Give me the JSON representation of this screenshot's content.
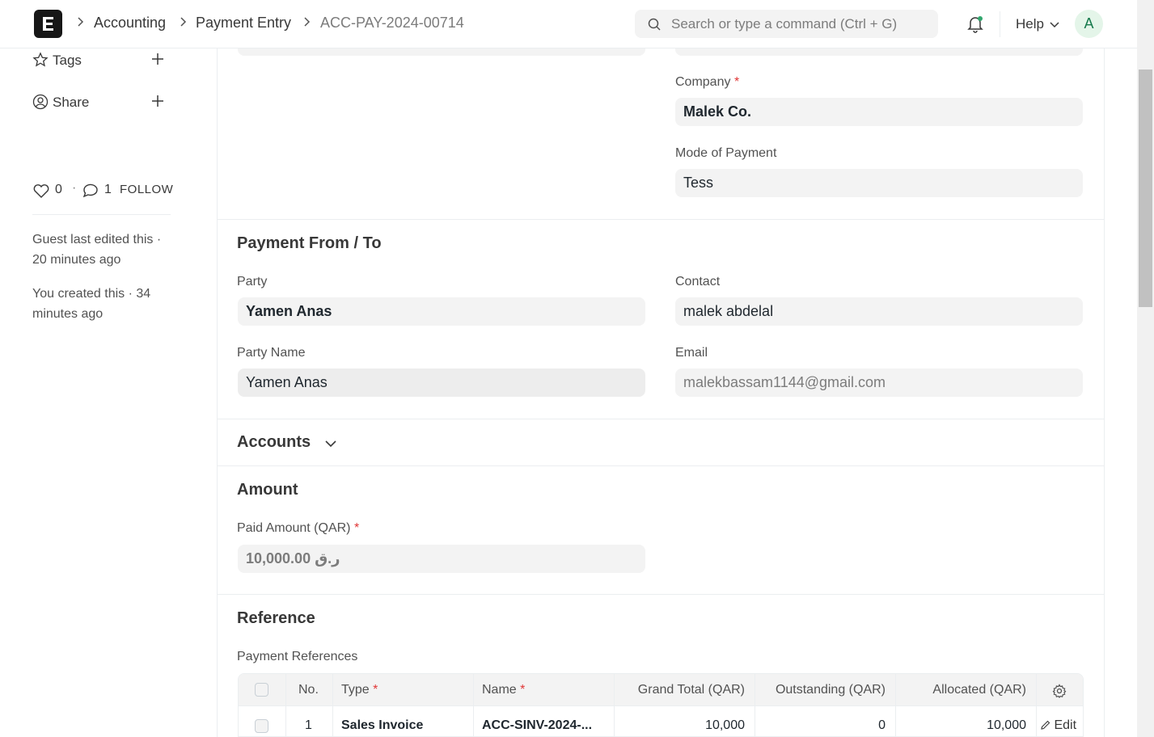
{
  "navbar": {
    "breadcrumbs": [
      "Accounting",
      "Payment Entry",
      "ACC-PAY-2024-00714"
    ],
    "search_placeholder": "Search or type a command (Ctrl + G)",
    "help_label": "Help",
    "avatar_initial": "A"
  },
  "sidebar": {
    "tags_label": "Tags",
    "share_label": "Share",
    "likes_count": "0",
    "comments_count": "1",
    "follow_label": "FOLLOW",
    "activity": [
      "Guest last edited this · 20 minutes ago",
      "You created this · 34 minutes ago"
    ]
  },
  "form": {
    "company_label": "Company",
    "company_value": "Malek Co.",
    "mode_label": "Mode of Payment",
    "mode_value": "Tess",
    "payment_section_title": "Payment From / To",
    "party_label": "Party",
    "party_value": "Yamen Anas",
    "contact_label": "Contact",
    "contact_value": "malek abdelal",
    "party_name_label": "Party Name",
    "party_name_value": "Yamen Anas",
    "email_label": "Email",
    "email_value": "malekbassam1144@gmail.com",
    "accounts_section_title": "Accounts",
    "amount_section_title": "Amount",
    "paid_amount_label": "Paid Amount (QAR)",
    "paid_amount_value": "ر.ق 10,000.00",
    "reference_section_title": "Reference",
    "references_label": "Payment References",
    "required_mark": "*"
  },
  "references_table": {
    "columns": [
      "No.",
      "Type",
      "Name",
      "Grand Total (QAR)",
      "Outstanding (QAR)",
      "Allocated (QAR)"
    ],
    "rows": [
      {
        "no": "1",
        "type": "Sales Invoice",
        "name": "ACC-SINV-2024-...",
        "grand_total": "10,000",
        "outstanding": "0",
        "allocated": "10,000"
      }
    ],
    "edit_label": "Edit"
  }
}
